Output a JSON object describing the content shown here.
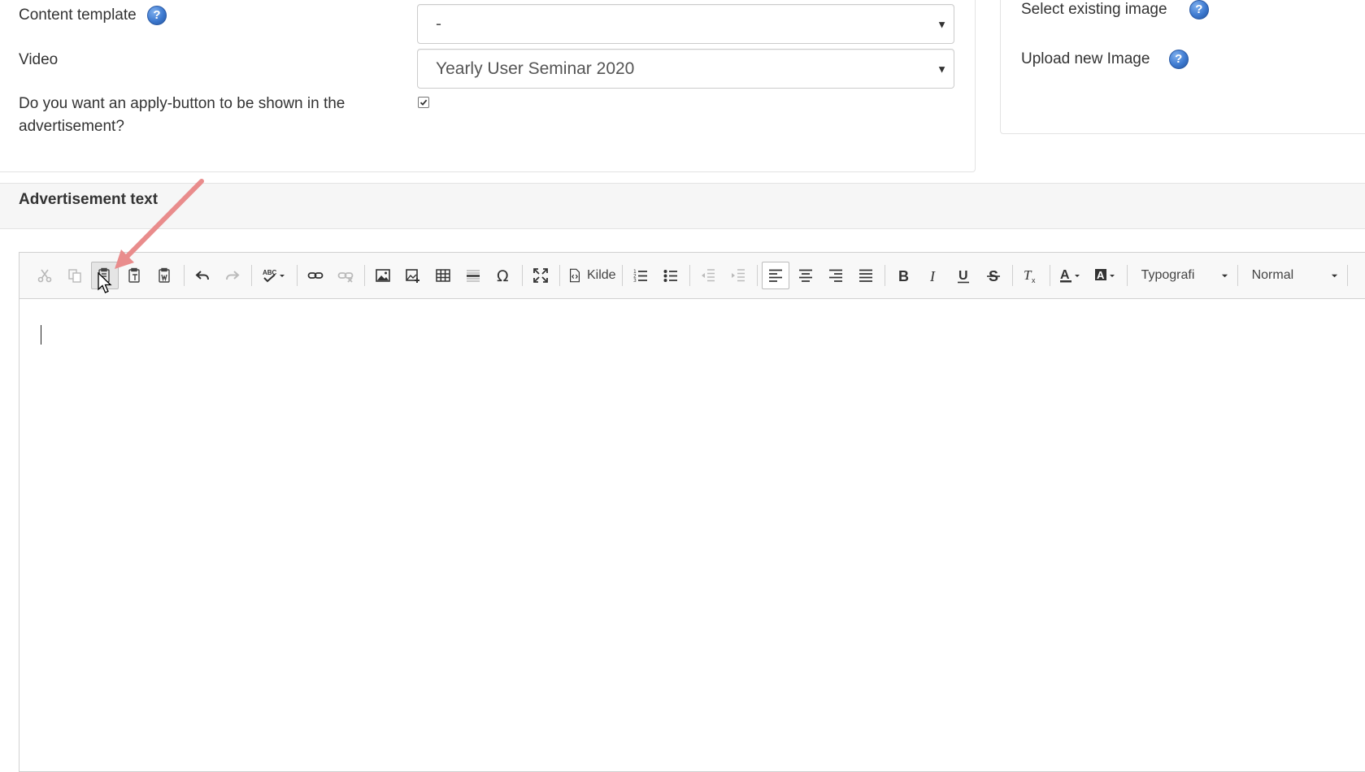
{
  "form": {
    "content_template": {
      "label": "Content template",
      "value": "-"
    },
    "video": {
      "label": "Video",
      "value": "Yearly User Seminar 2020"
    },
    "apply_button": {
      "label_line1": "Do you want an apply-button to be shown in the",
      "label_line2": "advertisement?",
      "checked": true
    }
  },
  "image_panel": {
    "select_existing": "Select existing image",
    "upload_new": "Upload new Image"
  },
  "help_glyph": "?",
  "section": {
    "title": "Advertisement text"
  },
  "editor": {
    "toolbar": {
      "source_label": "Kilde",
      "format_combo": "Typografi",
      "size_combo": "Normal"
    }
  },
  "colors": {
    "help_icon": "#3d79cf",
    "annotation_arrow": "#f08a8a",
    "toolbar_bg": "#f8f8f8",
    "section_header_bg": "#f6f6f6"
  }
}
